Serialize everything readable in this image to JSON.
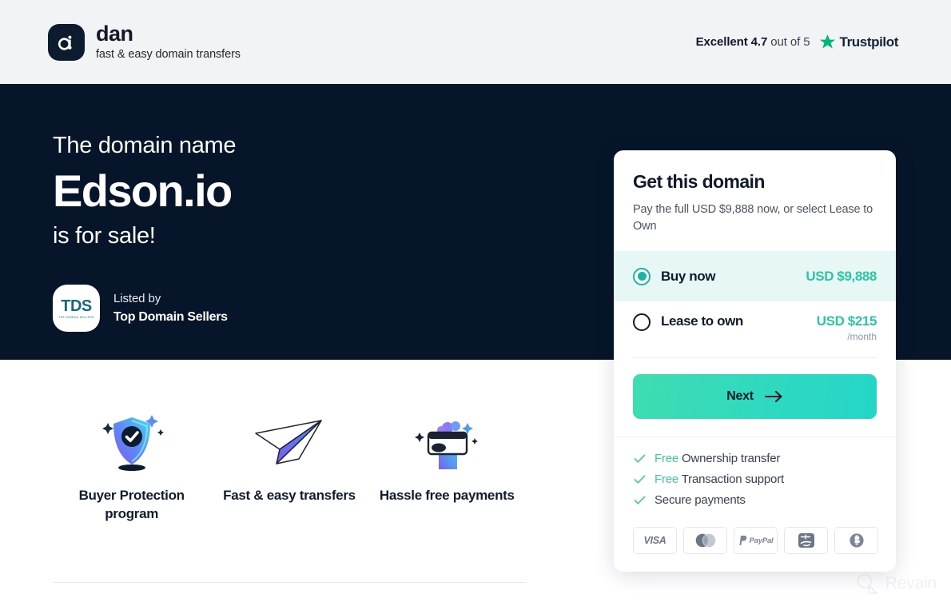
{
  "header": {
    "brand_name": "dan",
    "brand_tagline": "fast & easy domain transfers",
    "brand_mark_icon": "dan-logo-icon",
    "rating_prefix": "Excellent 4.7",
    "rating_suffix": " out of 5",
    "trustpilot_name": "Trustpilot",
    "trustpilot_star_icon": "star-icon",
    "trustpilot_green": "#00b67a",
    "header_bg": "#f1f3f5"
  },
  "hero": {
    "line1": "The domain name",
    "domain": "Edson.io",
    "line3": "is for sale!",
    "bg": "#061529",
    "seller": {
      "logo_text": "TDS",
      "logo_subtext": "THE DOMAIN SELLERS",
      "listed_by_label": "Listed by",
      "seller_name": "Top Domain Sellers"
    }
  },
  "features": [
    {
      "icon": "shield-check-icon",
      "label": "Buyer Protection program"
    },
    {
      "icon": "paper-plane-icon",
      "label": "Fast & easy transfers"
    },
    {
      "icon": "hand-credit-card-icon",
      "label": "Hassle free payments"
    }
  ],
  "card": {
    "title": "Get this domain",
    "subtitle": "Pay the full USD $9,888 now, or select Lease to Own",
    "options": [
      {
        "id": "buy-now",
        "label": "Buy now",
        "price": "USD $9,888",
        "period": "",
        "selected": true
      },
      {
        "id": "lease-to-own",
        "label": "Lease to own",
        "price": "USD $215",
        "period": "/month",
        "selected": false
      }
    ],
    "next_label": "Next",
    "next_arrow_icon": "arrow-right-icon",
    "accent_teal": "#2ec4a6",
    "selected_row_bg": "#e6f7f6",
    "perks": [
      {
        "free": "Free",
        "text": " Ownership transfer"
      },
      {
        "free": "Free",
        "text": " Transaction support"
      },
      {
        "free": "",
        "text": "Secure payments"
      }
    ],
    "payment_methods": [
      {
        "id": "visa",
        "label": "VISA"
      },
      {
        "id": "mastercard",
        "label": ""
      },
      {
        "id": "paypal",
        "label": "PayPal"
      },
      {
        "id": "alipay",
        "label": ""
      },
      {
        "id": "bitcoin",
        "label": ""
      }
    ]
  },
  "watermark": {
    "text": "Revain",
    "icon": "magnifier-icon"
  }
}
